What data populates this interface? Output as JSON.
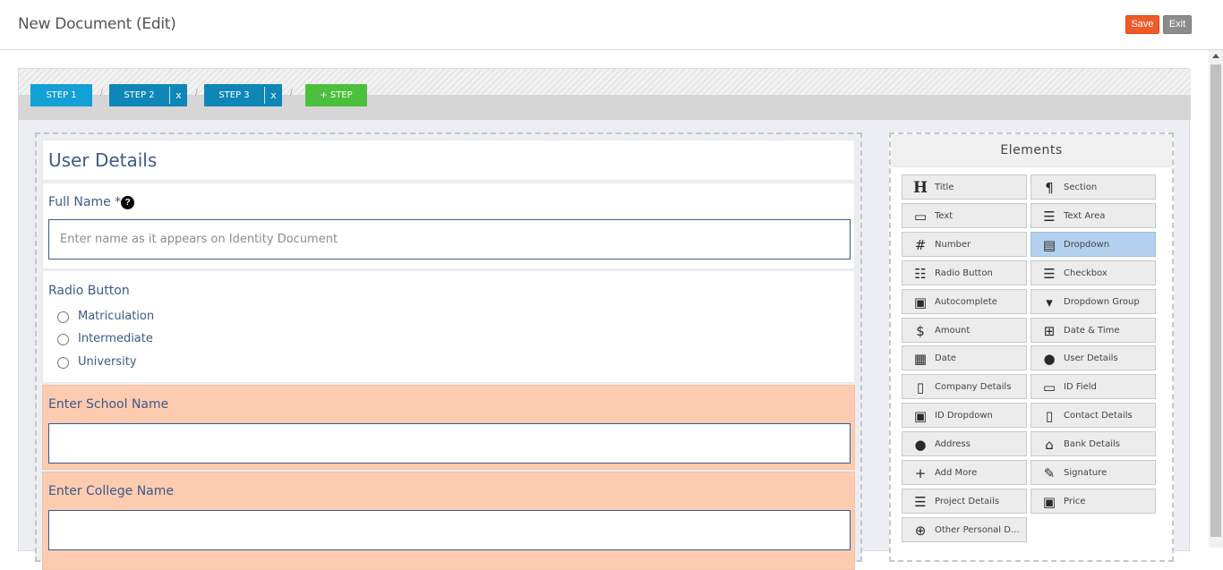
{
  "header": {
    "title": "New Document (Edit)",
    "save_label": "Save",
    "exit_label": "Exit"
  },
  "steps": [
    {
      "label": "STEP 1",
      "close": ""
    },
    {
      "label": "STEP 2",
      "close": "x"
    },
    {
      "label": "STEP 3",
      "close": "x"
    }
  ],
  "add_step_label": "+ STEP",
  "separator": "/",
  "form": {
    "section_title": "User Details",
    "full_name_label": "Full Name *",
    "help_glyph": "?",
    "full_name_placeholder": "Enter name as it appears on Identity Document",
    "radio_label": "Radio Button",
    "radio_options": [
      "Matriculation",
      "Intermediate",
      "University"
    ],
    "school_label": "Enter School Name",
    "college_label": "Enter College Name"
  },
  "elements": {
    "title": "Elements",
    "items": [
      {
        "label": "Title",
        "icon": "heading-icon"
      },
      {
        "label": "Section",
        "icon": "paragraph-icon"
      },
      {
        "label": "Text",
        "icon": "text-input-icon"
      },
      {
        "label": "Text Area",
        "icon": "text-area-icon"
      },
      {
        "label": "Number",
        "icon": "hash-icon"
      },
      {
        "label": "Dropdown",
        "icon": "dropdown-icon"
      },
      {
        "label": "Radio Button",
        "icon": "radio-list-icon"
      },
      {
        "label": "Checkbox",
        "icon": "checklist-icon"
      },
      {
        "label": "Autocomplete",
        "icon": "autocomplete-icon"
      },
      {
        "label": "Dropdown Group",
        "icon": "dropdown-group-icon"
      },
      {
        "label": "Amount",
        "icon": "dollar-icon"
      },
      {
        "label": "Date & Time",
        "icon": "calendar-plus-icon"
      },
      {
        "label": "Date",
        "icon": "calendar-icon"
      },
      {
        "label": "User Details",
        "icon": "user-icon"
      },
      {
        "label": "Company Details",
        "icon": "building-icon"
      },
      {
        "label": "ID Field",
        "icon": "id-card-icon"
      },
      {
        "label": "ID Dropdown",
        "icon": "id-badge-icon"
      },
      {
        "label": "Contact Details",
        "icon": "mobile-icon"
      },
      {
        "label": "Address",
        "icon": "map-marker-icon"
      },
      {
        "label": "Bank Details",
        "icon": "bank-icon"
      },
      {
        "label": "Add More",
        "icon": "plus-icon"
      },
      {
        "label": "Signature",
        "icon": "signature-icon"
      },
      {
        "label": "Project Details",
        "icon": "project-icon"
      },
      {
        "label": "Price",
        "icon": "money-icon"
      },
      {
        "label": "Other Personal D...",
        "icon": "plus-circle-icon"
      }
    ],
    "selected": "Dropdown"
  }
}
